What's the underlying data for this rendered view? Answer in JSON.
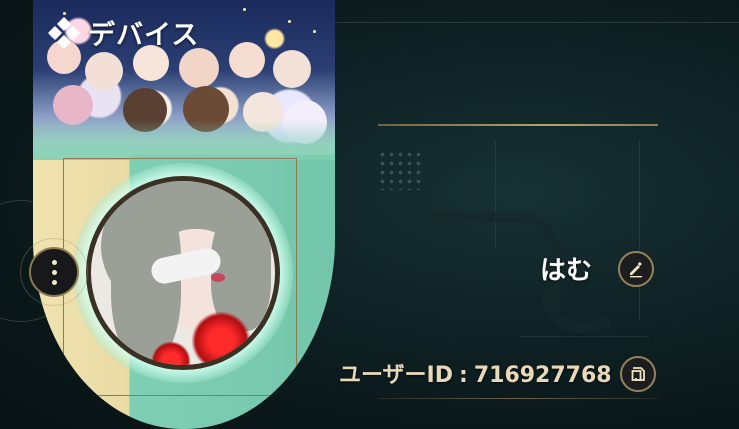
{
  "header": {
    "title": "デバイス",
    "icon": "diamond-grid-icon"
  },
  "profile": {
    "username": "はむ",
    "user_id_label": "ユーザーID",
    "user_id_separator": ":",
    "user_id_value": "716927768"
  },
  "icons": {
    "menu": "more-vertical-icon",
    "edit": "pencil-icon",
    "copy": "copy-icon"
  },
  "colors": {
    "accent_gold": "#978359",
    "background": "#0b1719",
    "id_text": "#e9d9b8",
    "card_left": "#efe3b0",
    "card_right": "#7fcfb4"
  }
}
